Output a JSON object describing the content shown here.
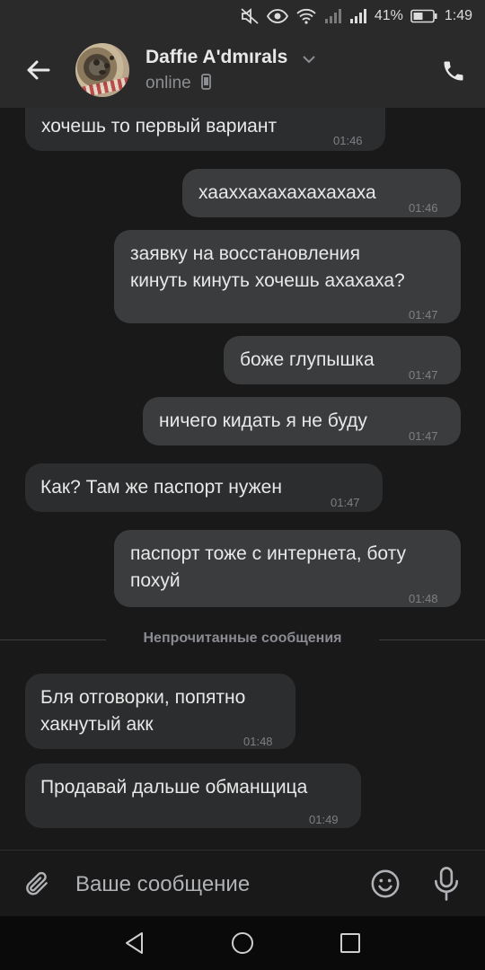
{
  "status_bar": {
    "battery_percent": "41%",
    "time": "1:49",
    "icons": [
      "mute-icon",
      "eye-comfort-icon",
      "wifi-icon",
      "signal-icon",
      "signal-icon",
      "battery-icon"
    ]
  },
  "header": {
    "contact_name": "Daffıe A'dmırals",
    "status": "online",
    "icons": [
      "back-arrow-icon",
      "chevron-down-icon",
      "mobile-device-icon",
      "phone-icon"
    ]
  },
  "messages": [
    {
      "direction": "in",
      "text": "хочешь то первый вариант",
      "time": "01:46"
    },
    {
      "direction": "out",
      "text": "хааххахахахахахаха",
      "time": "01:46"
    },
    {
      "direction": "out",
      "text": "заявку на восстановления\nкинуть кинуть хочешь ахахаха?",
      "time": "01:47"
    },
    {
      "direction": "out",
      "text": "боже глупышка",
      "time": "01:47"
    },
    {
      "direction": "out",
      "text": "ничего кидать я не буду",
      "time": "01:47"
    },
    {
      "direction": "in",
      "text": "Как? Там же паспорт нужен",
      "time": "01:47"
    },
    {
      "direction": "out",
      "text": "паспорт тоже с интернета, боту\nпохуй",
      "time": "01:48"
    },
    {
      "direction": "in",
      "text": "Бля отговорки, попятно\nхакнутый акк",
      "time": "01:48"
    },
    {
      "direction": "in",
      "text": "Продавай дальше обманщица",
      "time": "01:49"
    }
  ],
  "unread_divider": "Непрочитанные сообщения",
  "composer": {
    "placeholder": "Ваше сообщение",
    "icons": [
      "paperclip-icon",
      "emoji-icon",
      "microphone-icon"
    ]
  },
  "nav_bar": {
    "icons": [
      "nav-back-icon",
      "nav-home-icon",
      "nav-recents-icon"
    ]
  },
  "colors": {
    "background": "#19191a",
    "header": "#2a2a2b",
    "bubble_in": "#2c2d2e",
    "bubble_out": "#3b3c3e",
    "text": "#e8e8e8",
    "secondary_text": "#8c8e93"
  }
}
